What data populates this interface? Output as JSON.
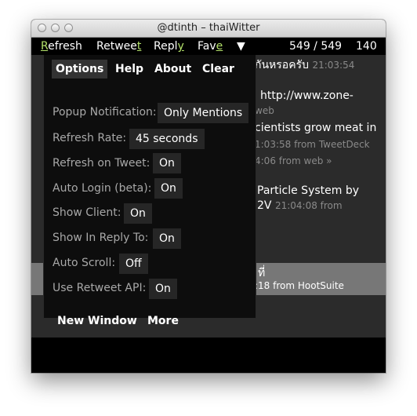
{
  "window": {
    "title": "@dtinth – thaiWitter"
  },
  "toolbar": {
    "refresh": {
      "pre": "",
      "acc": "R",
      "post": "efresh"
    },
    "retweet": {
      "pre": "Retwee",
      "acc": "t",
      "post": ""
    },
    "reply": {
      "pre": "Repl",
      "acc": "y",
      "post": ""
    },
    "fave": {
      "pre": "Fav",
      "acc": "e",
      "post": ""
    },
    "menu_arrow": "▼",
    "counter": "549 / 549",
    "chars": "140"
  },
  "feed": {
    "line1": {
      "text": "กันหรอครับ",
      "meta": "21:03:54"
    },
    "line2": {
      "text": "http://www.zone-"
    },
    "line3": {
      "meta": "web"
    },
    "line4": {
      "text": "cientists grow meat in"
    },
    "line5": {
      "meta": "1:03:58 from TweetDeck"
    },
    "line6": {
      "meta": "4:06 from web »"
    },
    "line7": {
      "text": "Particle System by"
    },
    "line8": {
      "text": "2V",
      "meta": "21:04:08 from"
    },
    "line9": {
      "text": "ที่"
    },
    "line10": {
      "meta": ":18 from HootSuite"
    }
  },
  "menu": {
    "tabs": [
      "Options",
      "Help",
      "About",
      "Clear"
    ],
    "settings": [
      {
        "label": "Popup Notification:",
        "value": "Only Mentions"
      },
      {
        "label": "Refresh Rate:",
        "value": "45 seconds"
      },
      {
        "label": "Refresh on Tweet:",
        "value": "On"
      },
      {
        "label": "Auto Login (beta):",
        "value": "On"
      },
      {
        "label": "Show Client:",
        "value": "On"
      },
      {
        "label": "Show In Reply To:",
        "value": "On"
      },
      {
        "label": "Auto Scroll:",
        "value": "Off"
      },
      {
        "label": "Use Retweet API:",
        "value": "On"
      }
    ],
    "new_window": "New Window",
    "more": "More"
  },
  "colors": {
    "accent": "#b3e16a",
    "toolbar_bg": "#000000",
    "panel_bg": "#0d0d0d",
    "value_bg": "#262626",
    "highlight_row": "#777777"
  }
}
